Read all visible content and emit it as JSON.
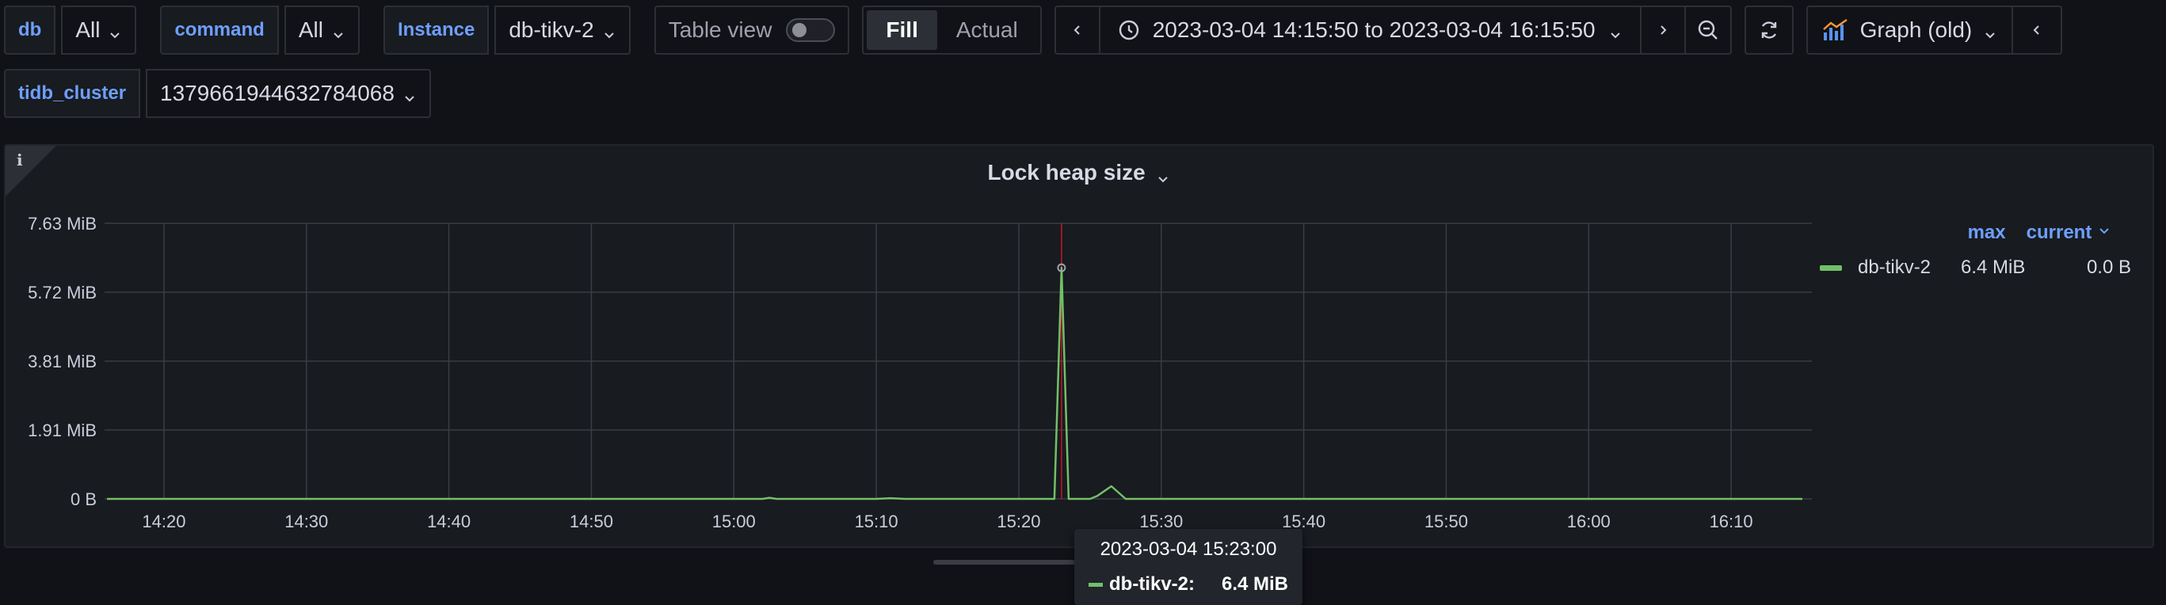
{
  "variables": [
    {
      "label": "db",
      "value": "All"
    },
    {
      "label": "command",
      "value": "All"
    },
    {
      "label": "Instance",
      "value": "db-tikv-2"
    }
  ],
  "cluster_var": {
    "label": "tidb_cluster",
    "value": "1379661944632784068"
  },
  "toolbar": {
    "table_view_label": "Table view",
    "table_view_on": false,
    "fill_label": "Fill",
    "actual_label": "Actual",
    "time_range": "2023-03-04 14:15:50 to 2023-03-04 16:15:50",
    "viz_label": "Graph (old)"
  },
  "panel": {
    "title": "Lock heap size",
    "info_icon": "i",
    "legend": {
      "headers": {
        "max": "max",
        "current": "current"
      },
      "series": [
        {
          "name": "db-tikv-2",
          "max": "6.4 MiB",
          "current": "0.0 B",
          "color": "#73bf69"
        }
      ]
    }
  },
  "chart_data": {
    "type": "line",
    "title": "Lock heap size",
    "x_start": "14:15:50",
    "x_end": "16:15:50",
    "x_ticks": [
      "14:20",
      "14:30",
      "14:40",
      "14:50",
      "15:00",
      "15:10",
      "15:20",
      "15:30",
      "15:40",
      "15:50",
      "16:00",
      "16:10"
    ],
    "y_ticks": [
      "0 B",
      "1.91 MiB",
      "3.81 MiB",
      "5.72 MiB",
      "7.63 MiB"
    ],
    "ylim_mib": [
      0,
      7.63
    ],
    "series": [
      {
        "name": "db-tikv-2",
        "color": "#73bf69",
        "points": [
          [
            "14:16",
            0
          ],
          [
            "15:02",
            0
          ],
          [
            "15:02:30",
            0.03
          ],
          [
            "15:03",
            0
          ],
          [
            "15:10",
            0
          ],
          [
            "15:11",
            0.02
          ],
          [
            "15:12",
            0
          ],
          [
            "15:22:30",
            0
          ],
          [
            "15:23:00",
            6.4
          ],
          [
            "15:23:30",
            0
          ],
          [
            "15:25",
            0
          ],
          [
            "15:25:30",
            0.08
          ],
          [
            "15:26:30",
            0.35
          ],
          [
            "15:27:30",
            0
          ],
          [
            "16:15",
            0
          ]
        ]
      }
    ],
    "hover_x": "15:23:00",
    "grid": true,
    "legend_position": "right"
  },
  "tooltip": {
    "time": "2023-03-04 15:23:00",
    "series": "db-tikv-2:",
    "value": "6.4 MiB"
  },
  "colors": {
    "accent": "#6e9fff",
    "series": "#73bf69",
    "crosshair": "#c4162a"
  }
}
